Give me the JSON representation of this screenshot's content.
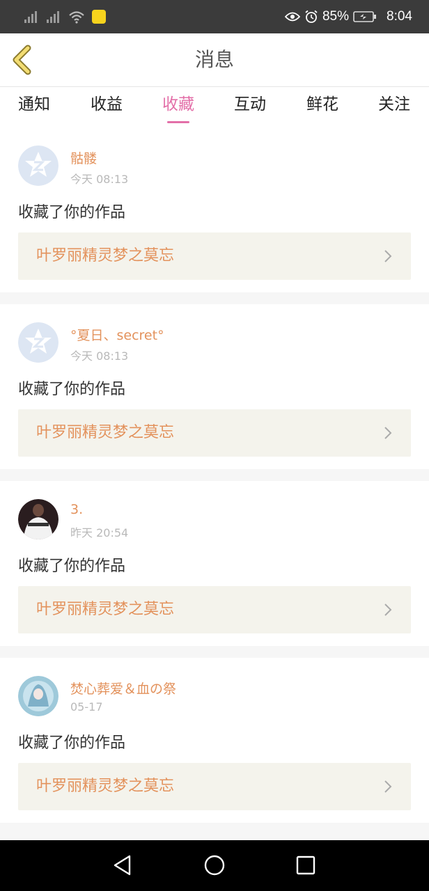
{
  "status_bar": {
    "battery": "85%",
    "time": "8:04",
    "icons": [
      "signal-icon",
      "signal-icon",
      "wifi-icon",
      "app-icon",
      "eye-icon",
      "alarm-icon",
      "battery-icon"
    ]
  },
  "header": {
    "title": "消息",
    "back_icon": "back-chevron-icon"
  },
  "tabs": [
    {
      "label": "通知",
      "active": false
    },
    {
      "label": "收益",
      "active": false
    },
    {
      "label": "收藏",
      "active": true
    },
    {
      "label": "互动",
      "active": false
    },
    {
      "label": "鲜花",
      "active": false
    },
    {
      "label": "关注",
      "active": false
    }
  ],
  "messages": [
    {
      "name": "骷髅",
      "time": "今天 08:13",
      "action": "收藏了你的作品",
      "work": "叶罗丽精灵梦之莫忘",
      "avatar": "default-qzone-avatar"
    },
    {
      "name": "°夏日、secret°",
      "time": "今天 08:13",
      "action": "收藏了你的作品",
      "work": "叶罗丽精灵梦之莫忘",
      "avatar": "default-qzone-avatar"
    },
    {
      "name": "3.",
      "time": "昨天 20:54",
      "action": "收藏了你的作品",
      "work": "叶罗丽精灵梦之莫忘",
      "avatar": "photo-avatar"
    },
    {
      "name": "焚心葬爱＆血の祭",
      "time": "05-17",
      "action": "收藏了你的作品",
      "work": "叶罗丽精灵梦之莫忘",
      "avatar": "anime-avatar"
    }
  ],
  "colors": {
    "accent_pink": "#e36fa8",
    "name_orange": "#e3925c",
    "status_bar": "#3b3b3b",
    "card_link_bg": "#f4f3ec"
  },
  "nav_bar": {
    "icons": [
      "back-triangle-icon",
      "home-circle-icon",
      "recents-square-icon"
    ]
  }
}
